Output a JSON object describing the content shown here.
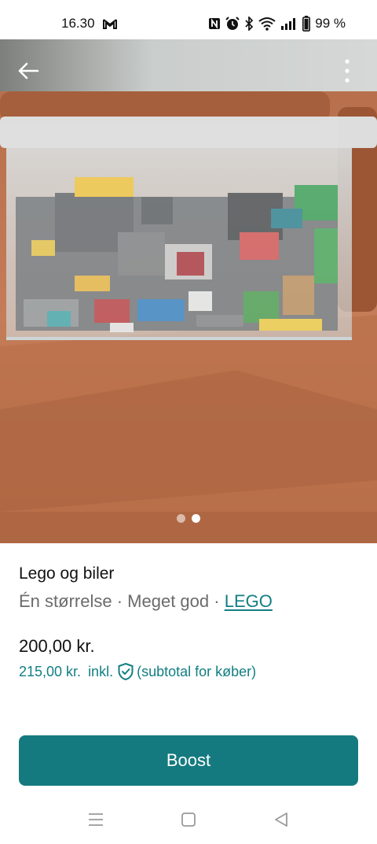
{
  "status_bar": {
    "time": "16.30",
    "battery": "99 %",
    "icons": [
      "gmail-icon",
      "nfc-icon",
      "alarm-icon",
      "bluetooth-icon",
      "wifi-icon",
      "signal-icon",
      "battery-icon"
    ]
  },
  "listing": {
    "title": "Lego og biler",
    "size": "Én størrelse",
    "condition": "Meget god",
    "separator": "·",
    "brand": "LEGO",
    "price": "200,00 kr.",
    "buyer_price": "215,00 kr.",
    "buyer_price_incl": "inkl.",
    "buyer_note": "(subtotal for køber)",
    "photo_count": 2,
    "photo_index": 2
  },
  "actions": {
    "boost_label": "Boost"
  },
  "nav": {
    "icons": [
      "recent-apps-icon",
      "home-icon",
      "back-nav-icon"
    ]
  },
  "colors": {
    "accent": "#157a7f",
    "link": "#127e83",
    "secondary_text": "#6b6b6b"
  }
}
